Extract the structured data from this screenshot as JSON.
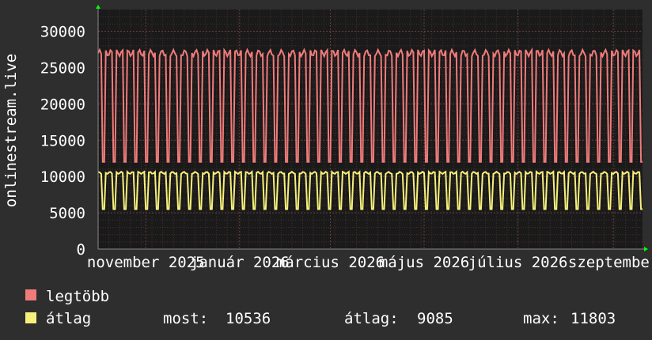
{
  "chart_data": {
    "type": "line",
    "ylabel": "onlinestream.live",
    "ylim": [
      0,
      33000
    ],
    "yticks": [
      0,
      5000,
      10000,
      15000,
      20000,
      25000,
      30000
    ],
    "x_domain": [
      "2025-10-01",
      "2026-09-20"
    ],
    "x_ticks": [
      {
        "label": "november 2025",
        "date": "2025-11-01"
      },
      {
        "label": "január 2026",
        "date": "2026-01-01"
      },
      {
        "label": "március 2026",
        "date": "2026-03-01"
      },
      {
        "label": "május 2026",
        "date": "2026-05-01"
      },
      {
        "label": "július 2026",
        "date": "2026-07-01"
      },
      {
        "label": "szeptember",
        "date": "2026-09-01"
      }
    ],
    "grid": true,
    "series": [
      {
        "name": "legtöbb",
        "color": "#f07b7b",
        "weekday_level": 27000,
        "weekend_level": 12000
      },
      {
        "name": "átlag",
        "color": "#f6f07a",
        "weekday_level": 10500,
        "weekend_level": 5500
      }
    ],
    "stats": {
      "most_label": "most:",
      "most_value": "10536",
      "atlag_label": "átlag:",
      "atlag_value": "9085",
      "max_label": "max:",
      "max_value": "11803"
    },
    "colors": {
      "background": "#2e2e2e",
      "plot_background": "#1a1a1a",
      "grid": "#4a2e2e",
      "text": "#ffffff",
      "arrow": "#00ff00"
    }
  }
}
